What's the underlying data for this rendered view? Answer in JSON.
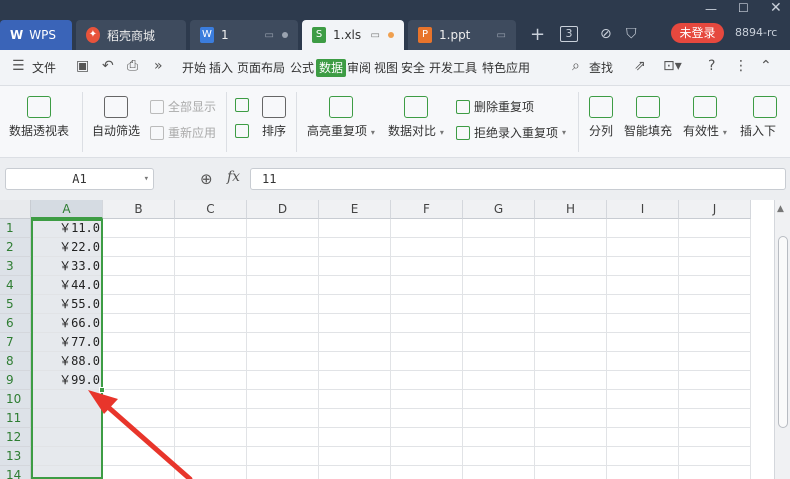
{
  "titlebar": {
    "tabs": [
      {
        "label": "WPS",
        "icon": "wps-logo-icon"
      },
      {
        "label": "稻壳商城",
        "icon": "docer-icon"
      },
      {
        "label": "1",
        "icon": "word-doc-icon"
      },
      {
        "label": "1.xls",
        "icon": "spreadsheet-icon"
      },
      {
        "label": "1.ppt",
        "icon": "presentation-icon"
      }
    ],
    "tab_count": "3",
    "login_label": "未登录",
    "user_id": "8894-rc",
    "new_tab": "+"
  },
  "menubar": {
    "file_label": "文件",
    "items": [
      "开始",
      "插入",
      "页面布局",
      "公式",
      "数据",
      "审阅",
      "视图",
      "安全",
      "开发工具",
      "特色应用"
    ],
    "active": "数据",
    "search_label": "查找"
  },
  "ribbon": {
    "pivot_table": "数据透视表",
    "auto_filter": "自动筛选",
    "show_all": "全部显示",
    "reapply": "重新应用",
    "sort": "排序",
    "highlight_dup": "高亮重复项",
    "data_compare": "数据对比",
    "delete_dup": "删除重复项",
    "reject_dup": "拒绝录入重复项",
    "split_column": "分列",
    "smart_fill": "智能填充",
    "validity": "有效性",
    "insert_dropdown": "插入下"
  },
  "formula": {
    "name_box": "A1",
    "value": "11",
    "fx": "fx"
  },
  "grid": {
    "columns": [
      "A",
      "B",
      "C",
      "D",
      "E",
      "F",
      "G",
      "H",
      "I",
      "J"
    ],
    "rows": [
      "1",
      "2",
      "3",
      "4",
      "5",
      "6",
      "7",
      "8",
      "9",
      "10",
      "11",
      "12",
      "13",
      "14"
    ],
    "col_a_values": [
      "￥11.0",
      "￥22.0",
      "￥33.0",
      "￥44.0",
      "￥55.0",
      "￥66.0",
      "￥77.0",
      "￥88.0",
      "￥99.0"
    ]
  },
  "colors": {
    "accent": "#3d9c44",
    "titlebar": "#2d3a4d",
    "login": "#e6483e",
    "arrow": "#e8352b"
  }
}
